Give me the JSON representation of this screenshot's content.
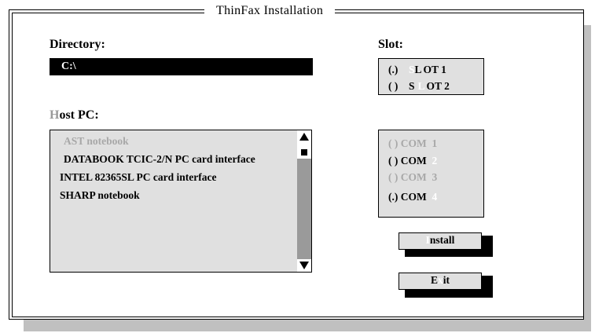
{
  "window": {
    "title": "ThinFax Installation"
  },
  "directory": {
    "label": "Directory:",
    "value": "C:\\"
  },
  "host_pc": {
    "label_hotkey": "H",
    "label_rest": "ost PC:",
    "items": [
      {
        "text": "AST notebook",
        "state": "disabled"
      },
      {
        "text": "DATABOOK TCIC-2/N PC card interface",
        "state": "normal"
      },
      {
        "text": "INTEL 82365SL PC card interface",
        "state": "normal"
      },
      {
        "text": "SHARP notebook",
        "state": "normal"
      }
    ]
  },
  "slot": {
    "label": "Slot:",
    "options": [
      {
        "mark": "(.)",
        "pre": "S",
        "hot": "L",
        "post": "OT 1",
        "selected": true
      },
      {
        "mark": "( )",
        "pre": "S",
        "hot": "L",
        "post": "OT 2",
        "selected": false
      }
    ]
  },
  "com": {
    "options": [
      {
        "mark": "( )",
        "name": "COM",
        "num": "1",
        "state": "disabled"
      },
      {
        "mark": "( )",
        "name": "COM",
        "num": "2",
        "state": "normal"
      },
      {
        "mark": "( )",
        "name": "COM",
        "num": "3",
        "state": "disabled"
      },
      {
        "mark": "(.)",
        "name": "COM",
        "num": "4",
        "state": "selected"
      }
    ]
  },
  "buttons": {
    "install": {
      "hot": "I",
      "rest": "nstall"
    },
    "exit": {
      "pre": "E",
      "hot": "x",
      "post": "it"
    }
  },
  "colors": {
    "background": "#ffffff",
    "panel": "#e0e0e0",
    "shadow": "#c0c0c0",
    "disabled": "#a8a8a8"
  }
}
